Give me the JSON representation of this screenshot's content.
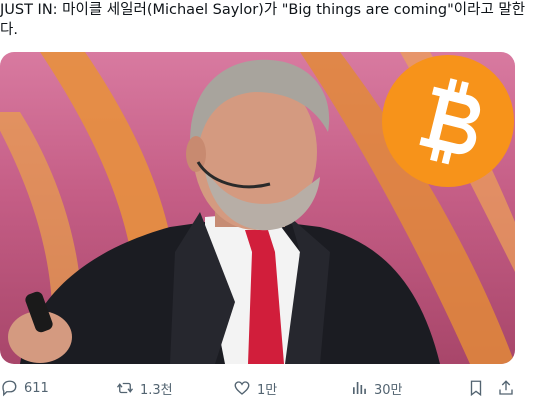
{
  "tweet": {
    "text": "JUST IN: 마이클 세일러(Michael Saylor)가 \"Big things are coming\"이라고 말한다."
  },
  "media": {
    "badge_icon": "bitcoin-icon",
    "badge_color": "#f7931a"
  },
  "actions": {
    "reply_count": "611",
    "retweet_count": "1.3천",
    "like_count": "1만",
    "view_count": "30만"
  },
  "colors": {
    "icon_gray": "#536471",
    "text": "#0f1419"
  }
}
